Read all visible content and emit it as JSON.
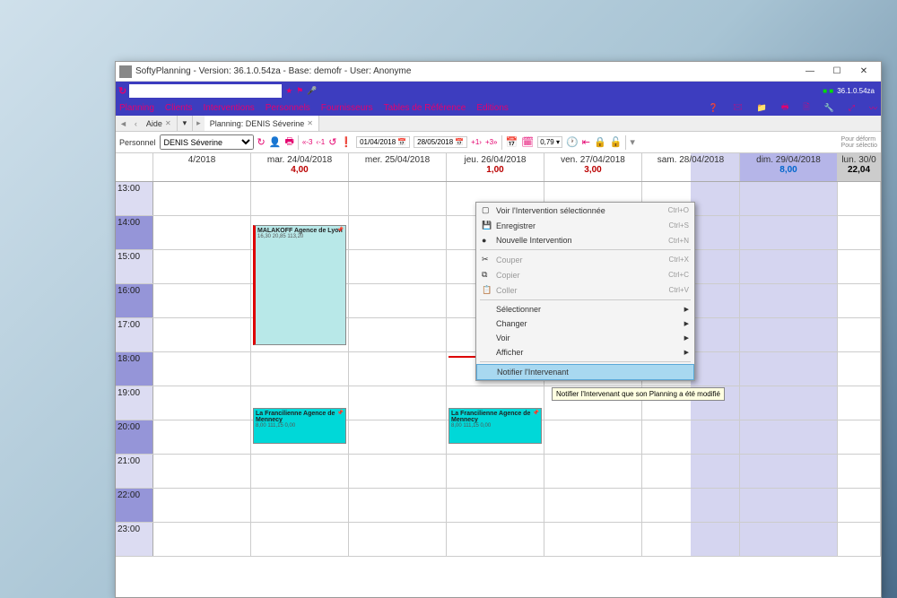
{
  "window_title": "SoftyPlanning - Version: 36.1.0.54za - Base: demofr - User: Anonyme",
  "version_badge": "36.1.0.54za",
  "menubar": [
    "Planning",
    "Clients",
    "Interventions",
    "Personnels",
    "Fournisseurs",
    "Tables de Référence",
    "Editions"
  ],
  "tabs": {
    "left": "Aide",
    "right": "Planning: DENIS Séverine"
  },
  "toolbar2": {
    "personnel_label": "Personnel",
    "personnel_value": "DENIS Séverine",
    "date_start": "01/04/2018",
    "date_end": "28/05/2018",
    "zoom": "0,79",
    "hint1": "Pour déform",
    "hint2": "Pour sélectio"
  },
  "days": [
    {
      "label": "4/2018",
      "sum": "",
      "cls": ""
    },
    {
      "label": "mar. 24/04/2018",
      "sum": "4,00",
      "cls": "red"
    },
    {
      "label": "mer. 25/04/2018",
      "sum": "",
      "cls": ""
    },
    {
      "label": "jeu. 26/04/2018",
      "sum": "1,00",
      "cls": "red"
    },
    {
      "label": "ven. 27/04/2018",
      "sum": "3,00",
      "cls": "red"
    },
    {
      "label": "sam. 28/04/2018",
      "sum": "",
      "cls": ""
    },
    {
      "label": "dim. 29/04/2018",
      "sum": "8,00",
      "cls": "blue"
    },
    {
      "label": "lun. 30/0",
      "sum": "22,04",
      "cls": ""
    }
  ],
  "hours": [
    "13:00",
    "14:00",
    "15:00",
    "16:00",
    "17:00",
    "18:00",
    "19:00",
    "20:00",
    "21:00",
    "22:00",
    "23:00"
  ],
  "events": {
    "malakoff": {
      "title": "MALAKOFF Agence de Lyon",
      "detail": "16,30  20,85  113,20"
    },
    "francilienne": {
      "title": "La Francilienne Agence de Mennecy",
      "detail": "8,00  111,15  0,00"
    }
  },
  "ctxmenu": [
    {
      "type": "item",
      "icon": "▢",
      "label": "Voir l'Intervention sélectionnée",
      "shortcut": "Ctrl+O"
    },
    {
      "type": "item",
      "icon": "💾",
      "label": "Enregistrer",
      "shortcut": "Ctrl+S"
    },
    {
      "type": "item",
      "icon": "●",
      "label": "Nouvelle Intervention",
      "shortcut": "Ctrl+N"
    },
    {
      "type": "sep"
    },
    {
      "type": "item",
      "icon": "✂",
      "label": "Couper",
      "shortcut": "Ctrl+X",
      "dis": true
    },
    {
      "type": "item",
      "icon": "⧉",
      "label": "Copier",
      "shortcut": "Ctrl+C",
      "dis": true
    },
    {
      "type": "item",
      "icon": "📋",
      "label": "Coller",
      "shortcut": "Ctrl+V",
      "dis": true
    },
    {
      "type": "sep"
    },
    {
      "type": "item",
      "label": "Sélectionner",
      "arrow": true
    },
    {
      "type": "item",
      "label": "Changer",
      "arrow": true
    },
    {
      "type": "item",
      "label": "Voir",
      "arrow": true
    },
    {
      "type": "item",
      "label": "Afficher",
      "arrow": true
    },
    {
      "type": "sep"
    },
    {
      "type": "item",
      "label": "Notifier l'Intervenant",
      "hl": true
    }
  ],
  "tooltip": "Notifier l'Intervenant que son Planning a été modifié"
}
